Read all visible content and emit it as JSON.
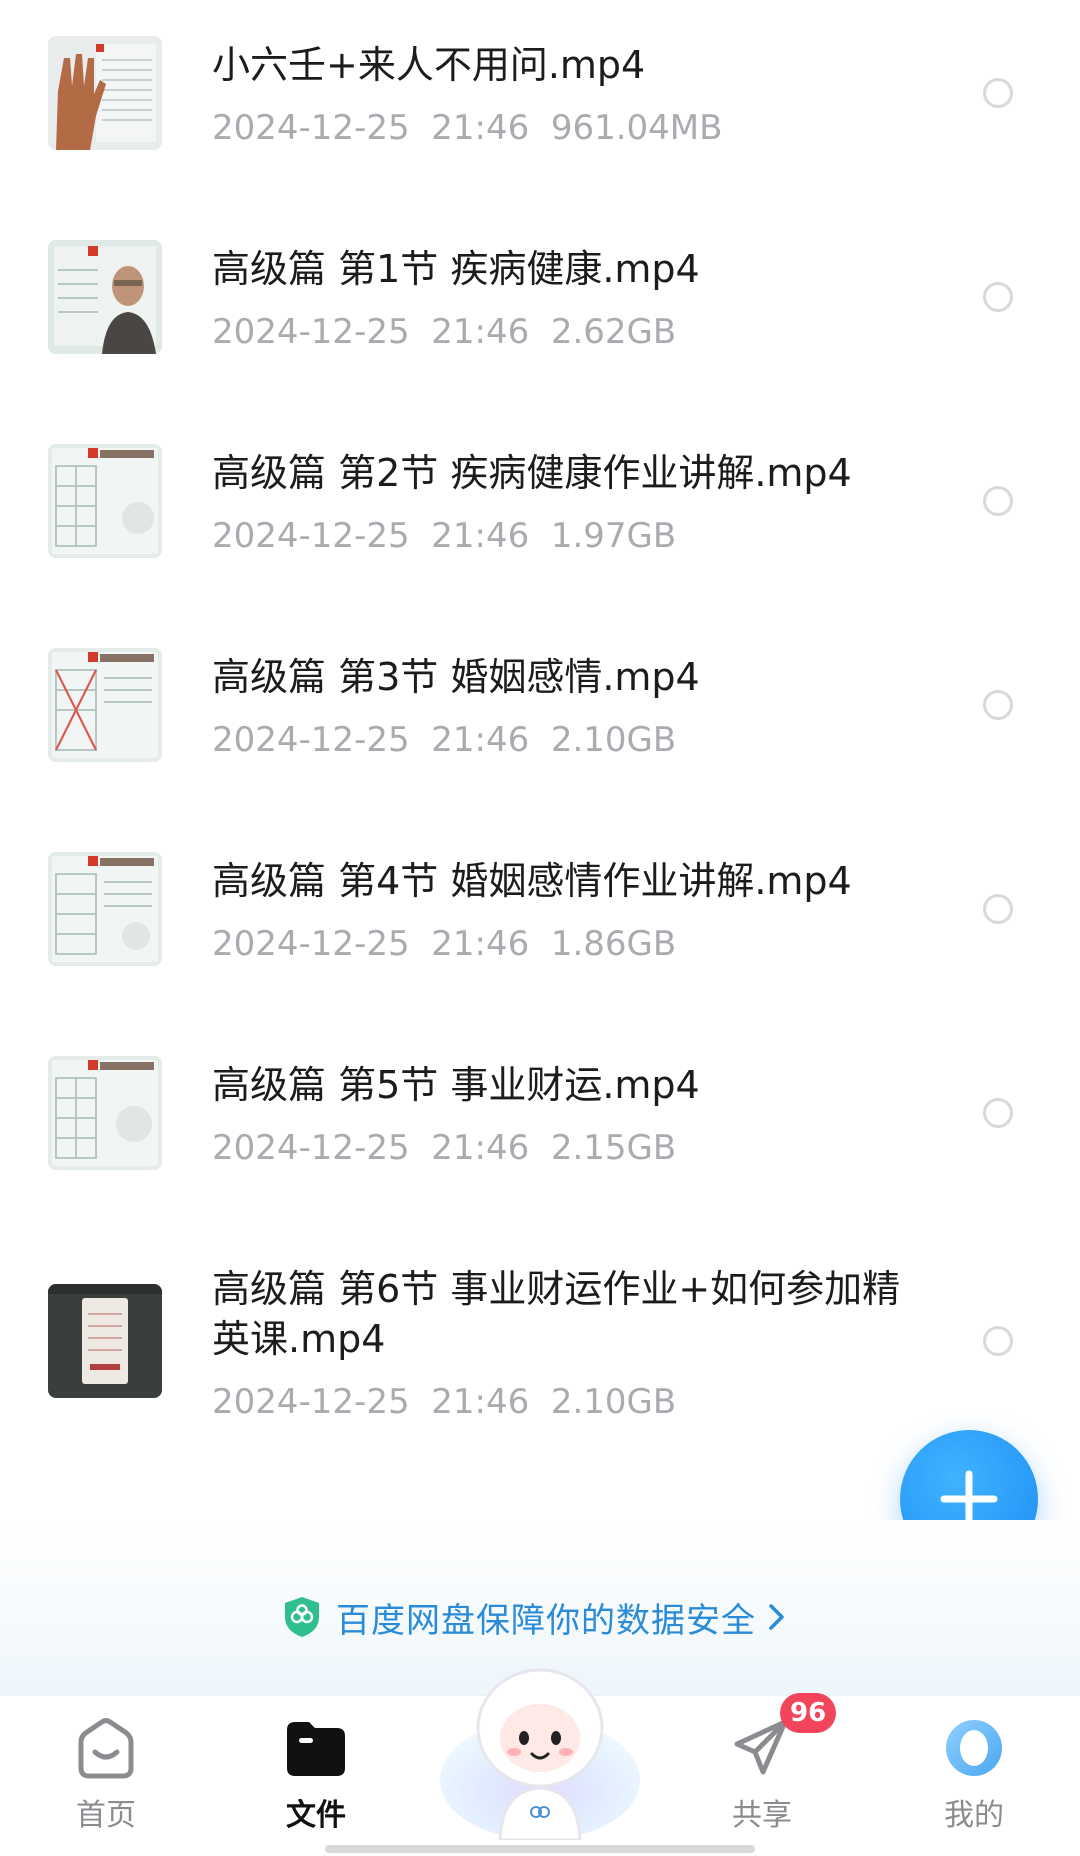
{
  "files": [
    {
      "name": "小六壬+来人不用问.mp4",
      "date": "2024-12-25",
      "time": "21:46",
      "size": "961.04MB",
      "thumb_icon": "video-thumbnail-hand"
    },
    {
      "name": "高级篇 第1节 疾病健康.mp4",
      "date": "2024-12-25",
      "time": "21:46",
      "size": "2.62GB",
      "thumb_icon": "video-thumbnail-lecturer"
    },
    {
      "name": "高级篇 第2节 疾病健康作业讲解.mp4",
      "date": "2024-12-25",
      "time": "21:46",
      "size": "1.97GB",
      "thumb_icon": "video-thumbnail-slides"
    },
    {
      "name": "高级篇 第3节 婚姻感情.mp4",
      "date": "2024-12-25",
      "time": "21:46",
      "size": "2.10GB",
      "thumb_icon": "video-thumbnail-slides"
    },
    {
      "name": "高级篇 第4节 婚姻感情作业讲解.mp4",
      "date": "2024-12-25",
      "time": "21:46",
      "size": "1.86GB",
      "thumb_icon": "video-thumbnail-slides"
    },
    {
      "name": "高级篇 第5节 事业财运.mp4",
      "date": "2024-12-25",
      "time": "21:46",
      "size": "2.15GB",
      "thumb_icon": "video-thumbnail-slides"
    },
    {
      "name": "高级篇 第6节 事业财运作业+如何参加精英课.mp4",
      "date": "2024-12-25",
      "time": "21:46",
      "size": "2.10GB",
      "thumb_icon": "video-thumbnail-screen"
    }
  ],
  "fab": {
    "icon": "plus-icon"
  },
  "promo": {
    "text": "百度网盘保障你的数据安全",
    "icon": "shield-icon",
    "chevron": "chevron-right-icon"
  },
  "tabs": [
    {
      "label": "首页",
      "icon": "home-icon"
    },
    {
      "label": "文件",
      "icon": "folder-icon",
      "active": true
    },
    {
      "label": "共享",
      "icon": "paper-plane-icon",
      "badge": "96"
    },
    {
      "label": "我的",
      "icon": "profile-icon"
    }
  ],
  "colors": {
    "accent": "#1f8cf5",
    "promo_text": "#2a8bd8",
    "badge": "#f2445b",
    "meta_text": "#a9abb0"
  }
}
